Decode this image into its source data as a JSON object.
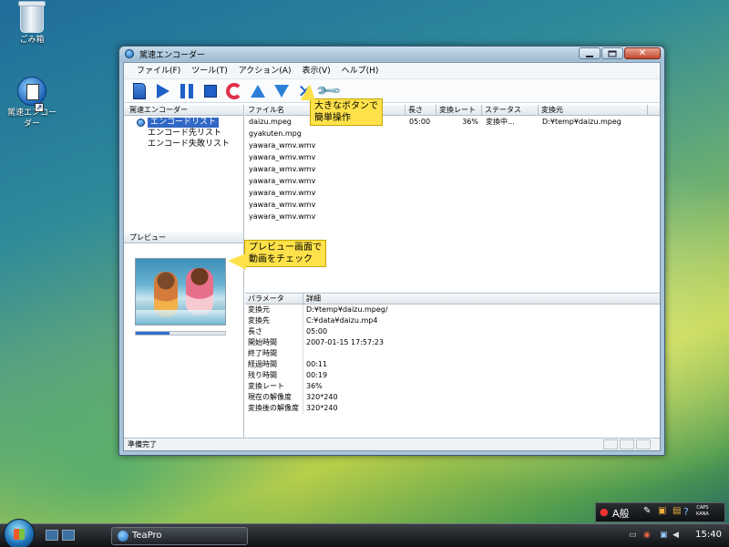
{
  "desktop": {
    "icons": [
      {
        "label": "ごみ箱"
      },
      {
        "label": "駕速エンコーダー"
      }
    ]
  },
  "window": {
    "title": "駕速エンコーダー",
    "menu": [
      "ファイル(F)",
      "ツール(T)",
      "アクション(A)",
      "表示(V)",
      "ヘルプ(H)"
    ],
    "toolbar": [
      {
        "icon": "new-file-icon"
      },
      {
        "icon": "play-icon"
      },
      {
        "icon": "pause-icon"
      },
      {
        "icon": "stop-icon"
      },
      {
        "icon": "refresh-icon"
      },
      {
        "icon": "move-up-icon"
      },
      {
        "icon": "move-down-icon"
      },
      {
        "icon": "delete-icon"
      },
      {
        "icon": "wrench-icon"
      }
    ],
    "tree": {
      "header": "駕速エンコーダー",
      "selected": "エンコードリスト",
      "items": [
        "エンコード先リスト",
        "エンコード失敗リスト"
      ]
    },
    "preview": {
      "header": "プレビュー",
      "progress_fraction": 0.38
    },
    "file_list": {
      "columns": [
        "ファイル名",
        "長さ",
        "変換レート",
        "ステータス",
        "変換元"
      ],
      "rows": [
        {
          "name": "daizu.mpeg",
          "length": "05:00",
          "rate": "36%",
          "status": "変換中...",
          "source": "D:¥temp¥daizu.mpeg"
        },
        {
          "name": "gyakuten.mpg",
          "length": "",
          "rate": "",
          "status": "",
          "source": ""
        },
        {
          "name": "yawara_wmv.wmv",
          "length": "",
          "rate": "",
          "status": "",
          "source": ""
        },
        {
          "name": "yawara_wmv.wmv",
          "length": "",
          "rate": "",
          "status": "",
          "source": ""
        },
        {
          "name": "yawara_wmv.wmv",
          "length": "",
          "rate": "",
          "status": "",
          "source": ""
        },
        {
          "name": "yawara_wmv.wmv",
          "length": "",
          "rate": "",
          "status": "",
          "source": ""
        },
        {
          "name": "yawara_wmv.wmv",
          "length": "",
          "rate": "",
          "status": "",
          "source": ""
        },
        {
          "name": "yawara_wmv.wmv",
          "length": "",
          "rate": "",
          "status": "",
          "source": ""
        },
        {
          "name": "yawara_wmv.wmv",
          "length": "",
          "rate": "",
          "status": "",
          "source": ""
        }
      ]
    },
    "details": {
      "columns": [
        "パラメータ",
        "詳細"
      ],
      "rows": [
        {
          "param": "変換元",
          "value": "D:¥temp¥daizu.mpeg/"
        },
        {
          "param": "変換先",
          "value": "C:¥data¥daizu.mp4"
        },
        {
          "param": "長さ",
          "value": "05:00"
        },
        {
          "param": "開始時間",
          "value": "2007-01-15 17:57:23"
        },
        {
          "param": "終了時間",
          "value": ""
        },
        {
          "param": "経過時間",
          "value": "00:11"
        },
        {
          "param": "残り時間",
          "value": "00:19"
        },
        {
          "param": "変換レート",
          "value": "36%"
        },
        {
          "param": "現在の解像度",
          "value": "320*240"
        },
        {
          "param": "変換後の解像度",
          "value": "320*240"
        }
      ]
    },
    "status": "準備完了"
  },
  "callouts": {
    "toolbar": "大きなボタンで\n簡単操作",
    "preview": "プレビュー画面で\n動画をチェック"
  },
  "taskbar": {
    "app_button": "TeaPro",
    "clock": "15:40"
  },
  "langbar": {
    "mode": "A般",
    "caps": "CAPS",
    "kana": "KANA"
  }
}
